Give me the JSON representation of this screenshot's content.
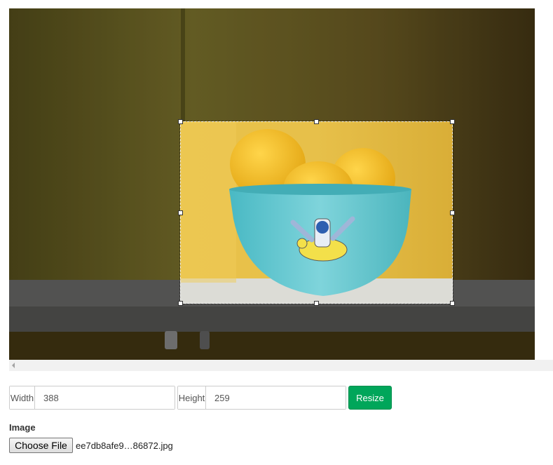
{
  "crop_tool": {
    "width_label": "Width",
    "width_value": "388",
    "height_label": "Height",
    "height_value": "259",
    "resize_label": "Resize"
  },
  "image_field": {
    "label": "Image",
    "choose_file_label": "Choose File",
    "file_name": "ee7db8afe9…86872.jpg"
  },
  "colors": {
    "resize_button": "#00a65a",
    "wall": "#6b5b1e",
    "bowl": "#5ec8cf",
    "lemon": "#f2b826"
  }
}
